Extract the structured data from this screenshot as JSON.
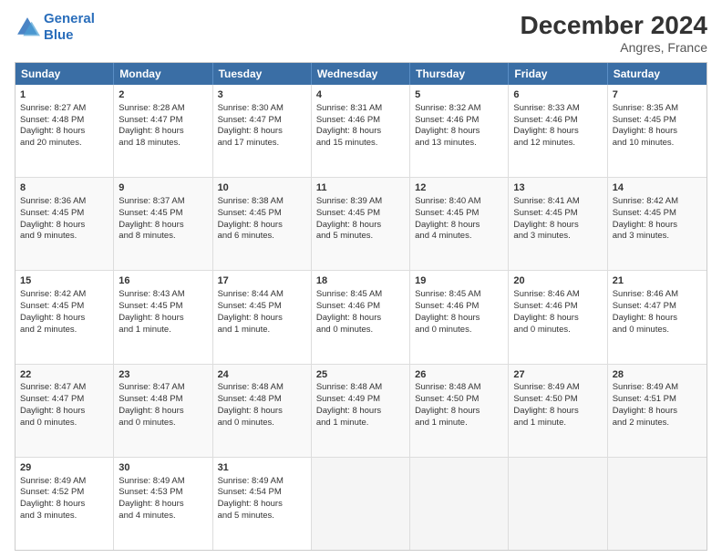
{
  "logo": {
    "line1": "General",
    "line2": "Blue"
  },
  "title": "December 2024",
  "subtitle": "Angres, France",
  "days_of_week": [
    "Sunday",
    "Monday",
    "Tuesday",
    "Wednesday",
    "Thursday",
    "Friday",
    "Saturday"
  ],
  "weeks": [
    [
      {
        "day": "1",
        "lines": [
          "Sunrise: 8:27 AM",
          "Sunset: 4:48 PM",
          "Daylight: 8 hours",
          "and 20 minutes."
        ]
      },
      {
        "day": "2",
        "lines": [
          "Sunrise: 8:28 AM",
          "Sunset: 4:47 PM",
          "Daylight: 8 hours",
          "and 18 minutes."
        ]
      },
      {
        "day": "3",
        "lines": [
          "Sunrise: 8:30 AM",
          "Sunset: 4:47 PM",
          "Daylight: 8 hours",
          "and 17 minutes."
        ]
      },
      {
        "day": "4",
        "lines": [
          "Sunrise: 8:31 AM",
          "Sunset: 4:46 PM",
          "Daylight: 8 hours",
          "and 15 minutes."
        ]
      },
      {
        "day": "5",
        "lines": [
          "Sunrise: 8:32 AM",
          "Sunset: 4:46 PM",
          "Daylight: 8 hours",
          "and 13 minutes."
        ]
      },
      {
        "day": "6",
        "lines": [
          "Sunrise: 8:33 AM",
          "Sunset: 4:46 PM",
          "Daylight: 8 hours",
          "and 12 minutes."
        ]
      },
      {
        "day": "7",
        "lines": [
          "Sunrise: 8:35 AM",
          "Sunset: 4:45 PM",
          "Daylight: 8 hours",
          "and 10 minutes."
        ]
      }
    ],
    [
      {
        "day": "8",
        "lines": [
          "Sunrise: 8:36 AM",
          "Sunset: 4:45 PM",
          "Daylight: 8 hours",
          "and 9 minutes."
        ]
      },
      {
        "day": "9",
        "lines": [
          "Sunrise: 8:37 AM",
          "Sunset: 4:45 PM",
          "Daylight: 8 hours",
          "and 8 minutes."
        ]
      },
      {
        "day": "10",
        "lines": [
          "Sunrise: 8:38 AM",
          "Sunset: 4:45 PM",
          "Daylight: 8 hours",
          "and 6 minutes."
        ]
      },
      {
        "day": "11",
        "lines": [
          "Sunrise: 8:39 AM",
          "Sunset: 4:45 PM",
          "Daylight: 8 hours",
          "and 5 minutes."
        ]
      },
      {
        "day": "12",
        "lines": [
          "Sunrise: 8:40 AM",
          "Sunset: 4:45 PM",
          "Daylight: 8 hours",
          "and 4 minutes."
        ]
      },
      {
        "day": "13",
        "lines": [
          "Sunrise: 8:41 AM",
          "Sunset: 4:45 PM",
          "Daylight: 8 hours",
          "and 3 minutes."
        ]
      },
      {
        "day": "14",
        "lines": [
          "Sunrise: 8:42 AM",
          "Sunset: 4:45 PM",
          "Daylight: 8 hours",
          "and 3 minutes."
        ]
      }
    ],
    [
      {
        "day": "15",
        "lines": [
          "Sunrise: 8:42 AM",
          "Sunset: 4:45 PM",
          "Daylight: 8 hours",
          "and 2 minutes."
        ]
      },
      {
        "day": "16",
        "lines": [
          "Sunrise: 8:43 AM",
          "Sunset: 4:45 PM",
          "Daylight: 8 hours",
          "and 1 minute."
        ]
      },
      {
        "day": "17",
        "lines": [
          "Sunrise: 8:44 AM",
          "Sunset: 4:45 PM",
          "Daylight: 8 hours",
          "and 1 minute."
        ]
      },
      {
        "day": "18",
        "lines": [
          "Sunrise: 8:45 AM",
          "Sunset: 4:46 PM",
          "Daylight: 8 hours",
          "and 0 minutes."
        ]
      },
      {
        "day": "19",
        "lines": [
          "Sunrise: 8:45 AM",
          "Sunset: 4:46 PM",
          "Daylight: 8 hours",
          "and 0 minutes."
        ]
      },
      {
        "day": "20",
        "lines": [
          "Sunrise: 8:46 AM",
          "Sunset: 4:46 PM",
          "Daylight: 8 hours",
          "and 0 minutes."
        ]
      },
      {
        "day": "21",
        "lines": [
          "Sunrise: 8:46 AM",
          "Sunset: 4:47 PM",
          "Daylight: 8 hours",
          "and 0 minutes."
        ]
      }
    ],
    [
      {
        "day": "22",
        "lines": [
          "Sunrise: 8:47 AM",
          "Sunset: 4:47 PM",
          "Daylight: 8 hours",
          "and 0 minutes."
        ]
      },
      {
        "day": "23",
        "lines": [
          "Sunrise: 8:47 AM",
          "Sunset: 4:48 PM",
          "Daylight: 8 hours",
          "and 0 minutes."
        ]
      },
      {
        "day": "24",
        "lines": [
          "Sunrise: 8:48 AM",
          "Sunset: 4:48 PM",
          "Daylight: 8 hours",
          "and 0 minutes."
        ]
      },
      {
        "day": "25",
        "lines": [
          "Sunrise: 8:48 AM",
          "Sunset: 4:49 PM",
          "Daylight: 8 hours",
          "and 1 minute."
        ]
      },
      {
        "day": "26",
        "lines": [
          "Sunrise: 8:48 AM",
          "Sunset: 4:50 PM",
          "Daylight: 8 hours",
          "and 1 minute."
        ]
      },
      {
        "day": "27",
        "lines": [
          "Sunrise: 8:49 AM",
          "Sunset: 4:50 PM",
          "Daylight: 8 hours",
          "and 1 minute."
        ]
      },
      {
        "day": "28",
        "lines": [
          "Sunrise: 8:49 AM",
          "Sunset: 4:51 PM",
          "Daylight: 8 hours",
          "and 2 minutes."
        ]
      }
    ],
    [
      {
        "day": "29",
        "lines": [
          "Sunrise: 8:49 AM",
          "Sunset: 4:52 PM",
          "Daylight: 8 hours",
          "and 3 minutes."
        ]
      },
      {
        "day": "30",
        "lines": [
          "Sunrise: 8:49 AM",
          "Sunset: 4:53 PM",
          "Daylight: 8 hours",
          "and 4 minutes."
        ]
      },
      {
        "day": "31",
        "lines": [
          "Sunrise: 8:49 AM",
          "Sunset: 4:54 PM",
          "Daylight: 8 hours",
          "and 5 minutes."
        ]
      },
      null,
      null,
      null,
      null
    ]
  ]
}
